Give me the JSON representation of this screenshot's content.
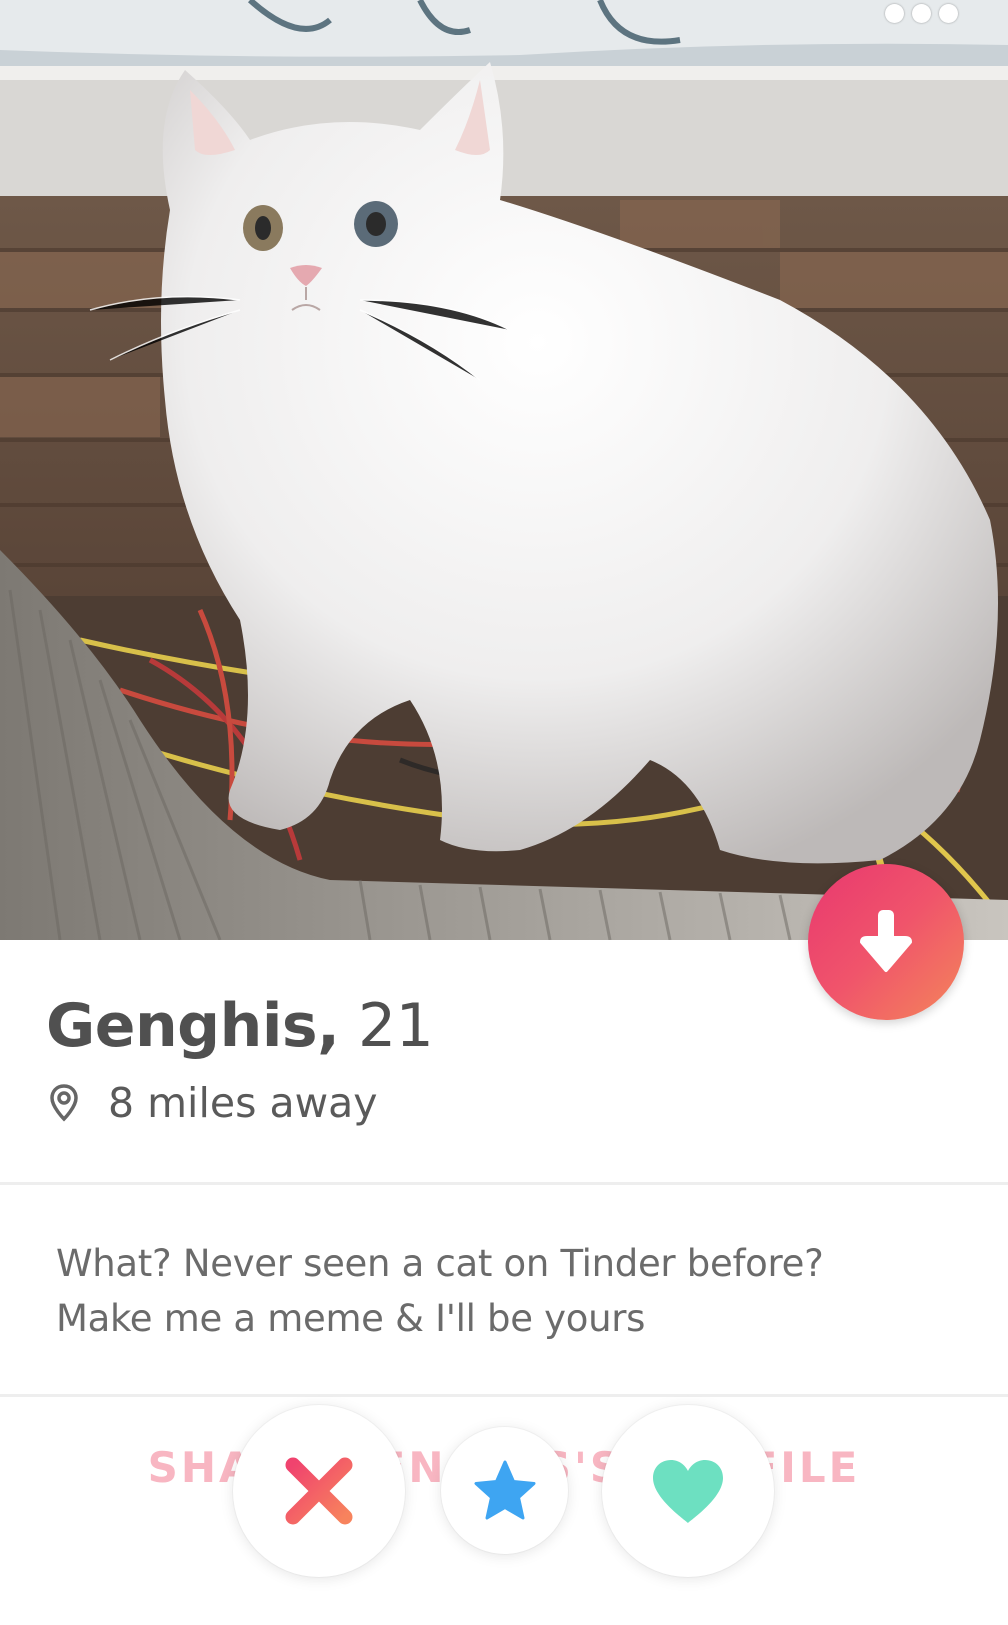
{
  "profile": {
    "name": "Genghis,",
    "age": "21",
    "distance": "8 miles away",
    "bio_lines": [
      "What? Never seen a cat on Tinder before?",
      "Make me a meme & I'll be yours"
    ]
  },
  "share_link": {
    "label": "SHARE GENGHIS'S PROFILE"
  },
  "icons": {
    "more": "more-horizontal-icon",
    "collapse": "arrow-down-icon",
    "location": "location-pin-icon",
    "nope": "close-x-icon",
    "super_like": "star-icon",
    "like": "heart-icon"
  },
  "colors": {
    "collapse_gradient_start": "#e8386f",
    "collapse_gradient_end": "#f4865a",
    "nope_gradient_start": "#f0436e",
    "nope_gradient_end": "#f7835d",
    "super_like": "#3ea5f2",
    "like": "#6de0c1",
    "share_link": "#f8b6c2",
    "text_primary": "#505050"
  }
}
